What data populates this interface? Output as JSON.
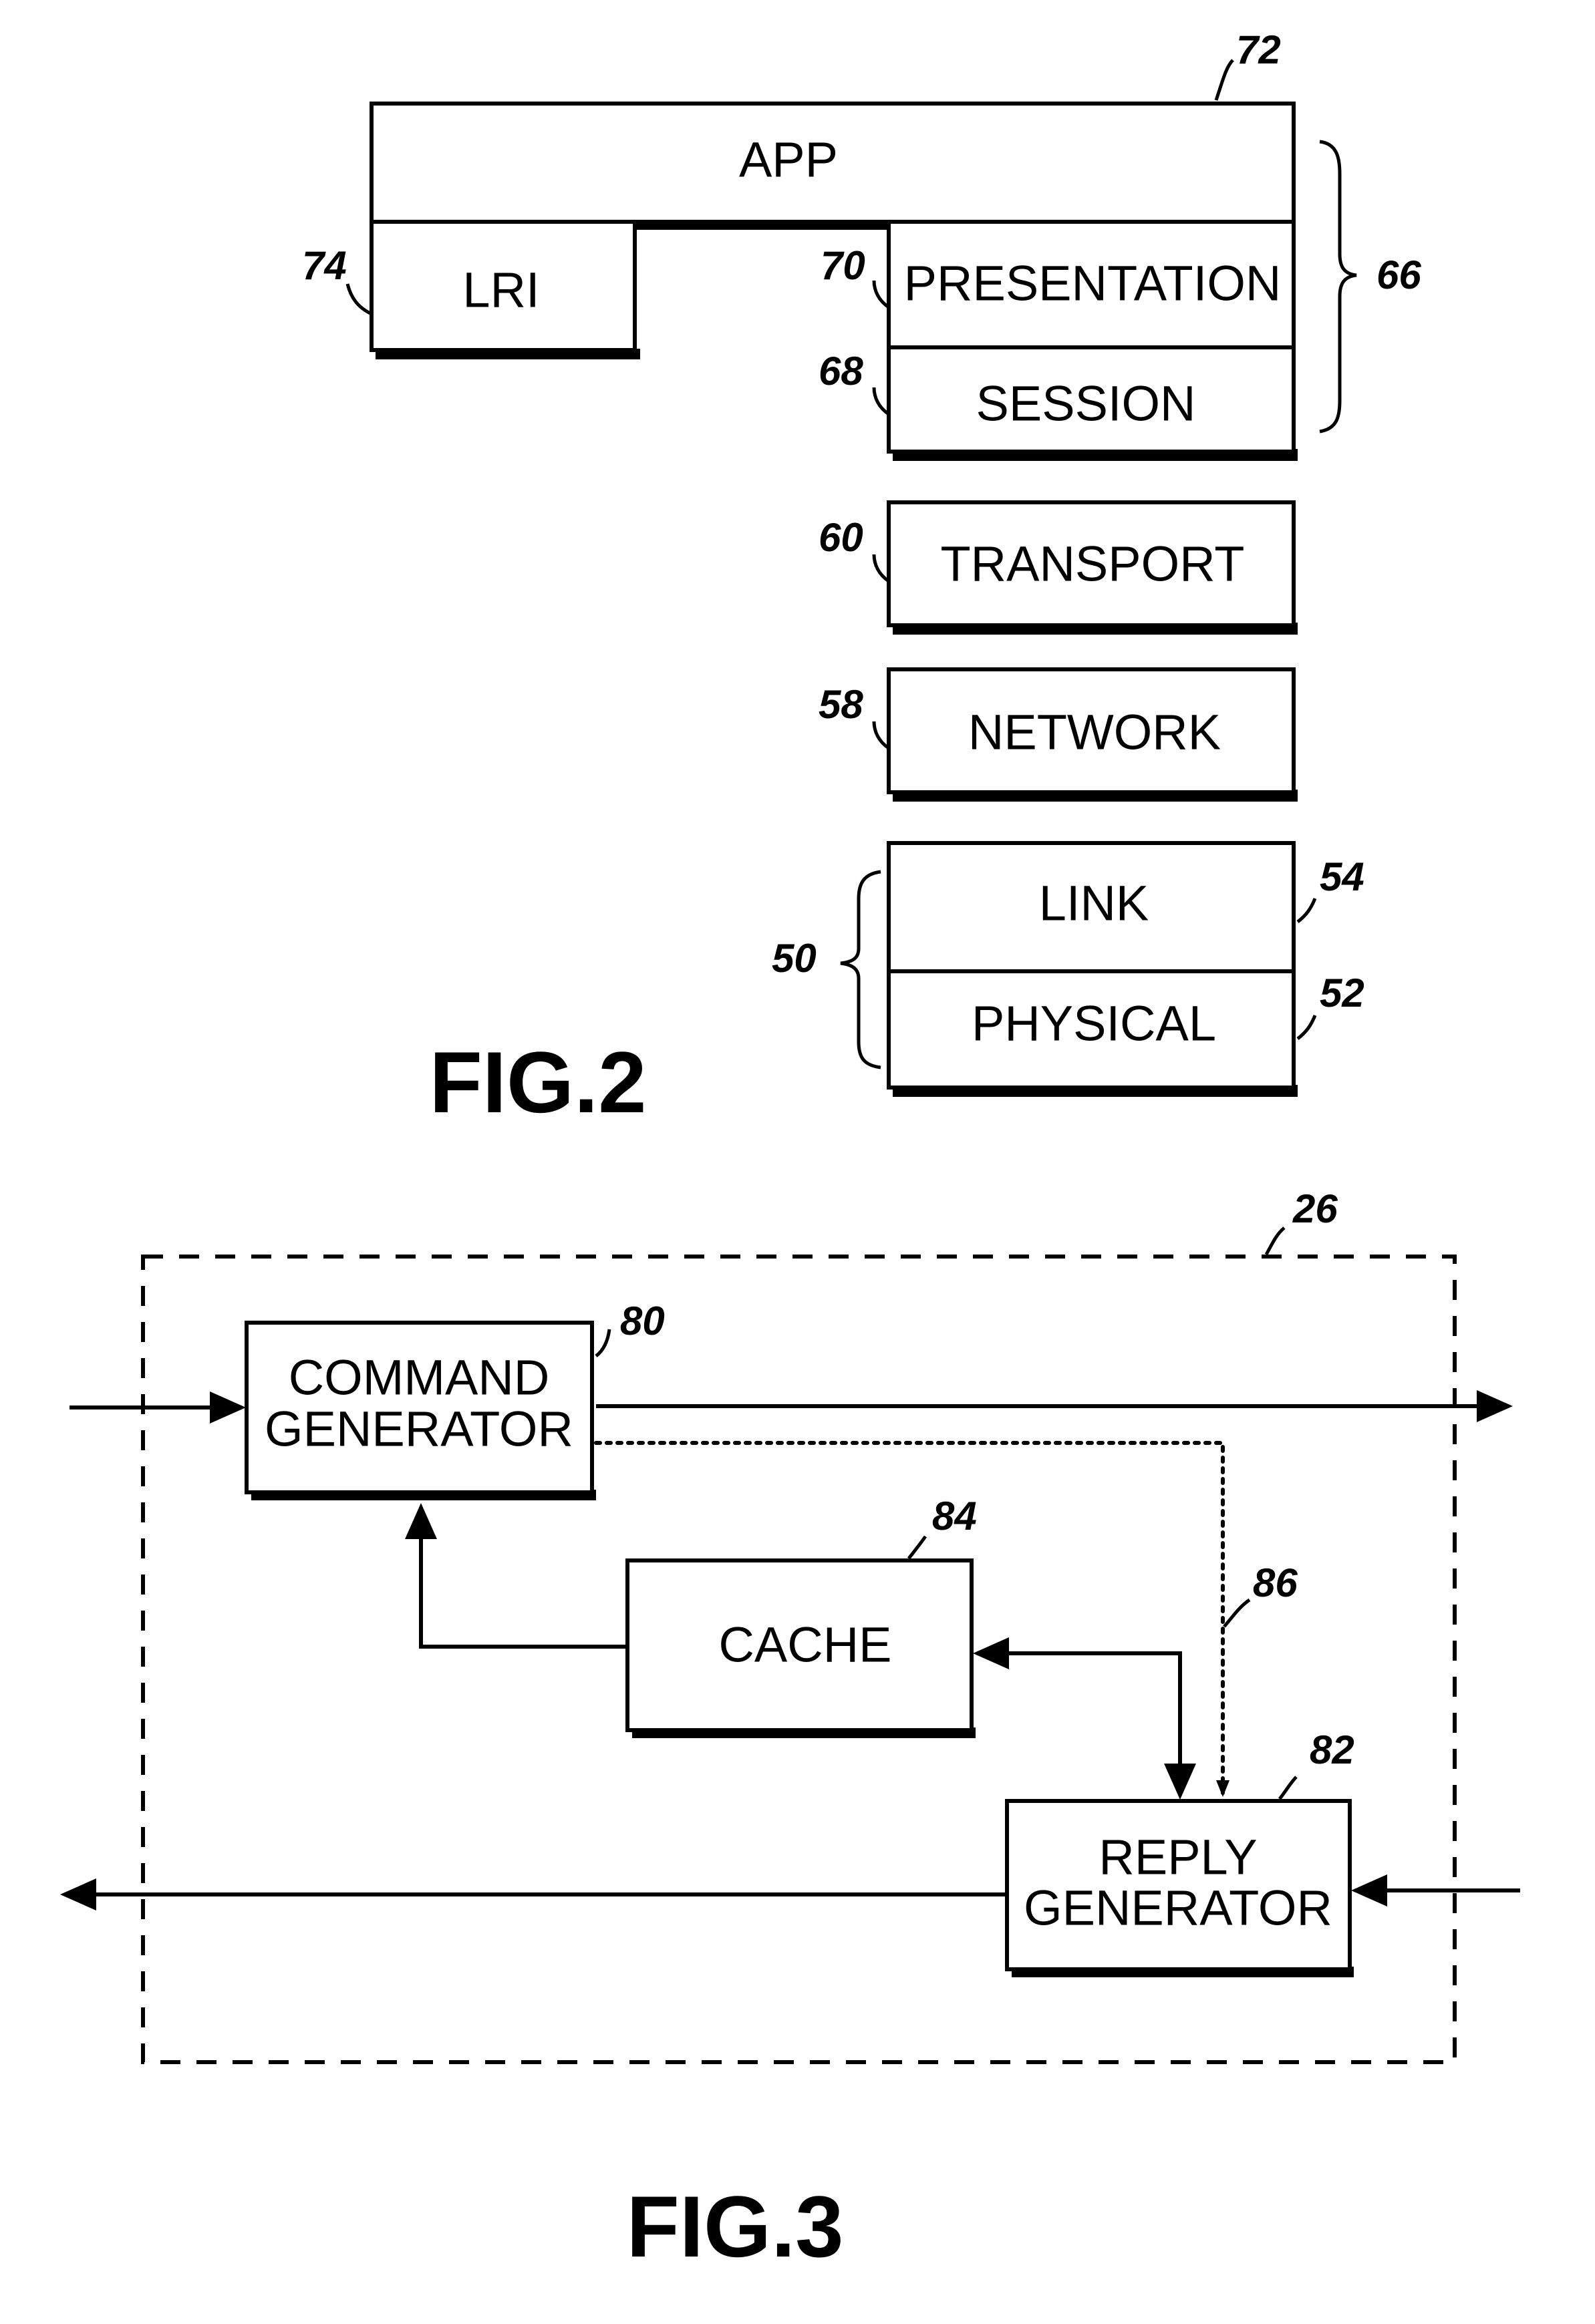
{
  "fig2": {
    "caption": "FIG.2",
    "layers": {
      "app": {
        "label": "APP",
        "ref": "72"
      },
      "lri": {
        "label": "LRI",
        "ref": "74"
      },
      "presentation": {
        "label": "PRESENTATION",
        "ref": "70"
      },
      "session": {
        "label": "SESSION",
        "ref": "68"
      },
      "transport": {
        "label": "TRANSPORT",
        "ref": "60"
      },
      "network": {
        "label": "NETWORK",
        "ref": "58"
      },
      "link": {
        "label": "LINK",
        "ref": "54"
      },
      "physical": {
        "label": "PHYSICAL",
        "ref": "52"
      }
    },
    "brace_upper_ref": "66",
    "brace_lower_ref": "50"
  },
  "fig3": {
    "caption": "FIG.3",
    "container_ref": "26",
    "command_generator": {
      "line1": "COMMAND",
      "line2": "GENERATOR",
      "ref": "80"
    },
    "cache": {
      "label": "CACHE",
      "ref": "84"
    },
    "reply_generator": {
      "line1": "REPLY",
      "line2": "GENERATOR",
      "ref": "82"
    },
    "dotted_path_ref": "86"
  }
}
